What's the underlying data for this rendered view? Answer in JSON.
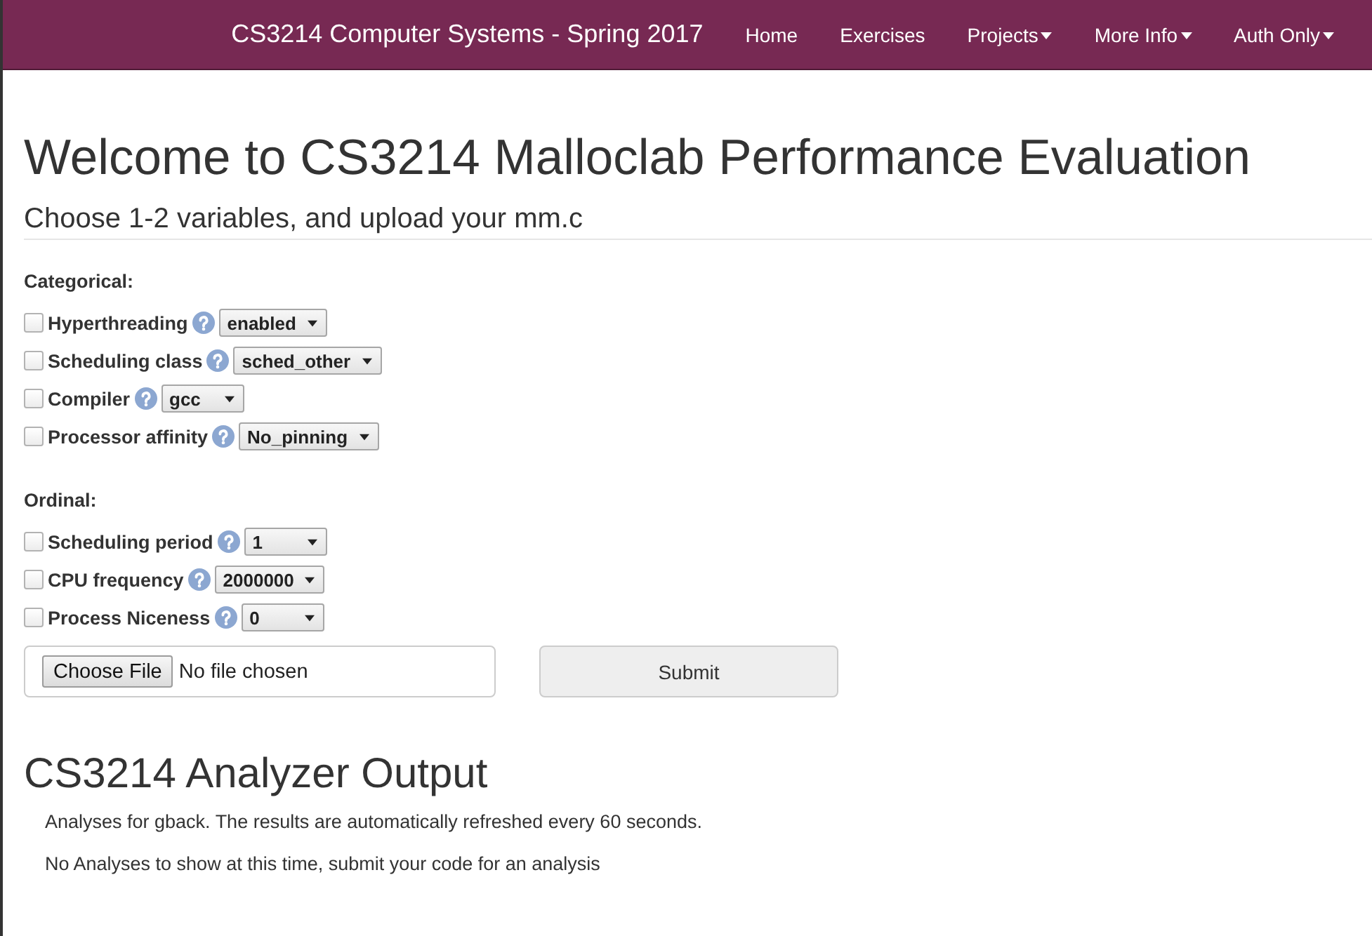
{
  "navbar": {
    "brand": "CS3214 Computer Systems - Spring 2017",
    "items": [
      {
        "label": "Home",
        "has_menu": false
      },
      {
        "label": "Exercises",
        "has_menu": false
      },
      {
        "label": "Projects",
        "has_menu": true
      },
      {
        "label": "More Info",
        "has_menu": true
      },
      {
        "label": "Auth Only",
        "has_menu": true
      }
    ]
  },
  "header": {
    "title": "Welcome to CS3214 Malloclab Performance Evaluation",
    "subtitle": "Choose 1-2 variables, and upload your mm.c"
  },
  "form": {
    "groups": [
      {
        "heading": "Categorical:",
        "variables": [
          {
            "label": "Hyperthreading",
            "checked": false,
            "value": "enabled"
          },
          {
            "label": "Scheduling class",
            "checked": false,
            "value": "sched_other"
          },
          {
            "label": "Compiler",
            "checked": false,
            "value": "gcc"
          },
          {
            "label": "Processor affinity",
            "checked": false,
            "value": "No_pinning"
          }
        ]
      },
      {
        "heading": "Ordinal:",
        "variables": [
          {
            "label": "Scheduling period",
            "checked": false,
            "value": "1"
          },
          {
            "label": "CPU frequency",
            "checked": false,
            "value": "2000000"
          },
          {
            "label": "Process Niceness",
            "checked": false,
            "value": "0"
          }
        ]
      }
    ],
    "file_input": {
      "button": "Choose File",
      "status": "No file chosen"
    },
    "submit": "Submit"
  },
  "output": {
    "title": "CS3214 Analyzer Output",
    "messages": [
      "Analyses for gback. The results are automatically refreshed every 60 seconds.",
      "No Analyses to show at this time, submit your code for an analysis"
    ]
  }
}
